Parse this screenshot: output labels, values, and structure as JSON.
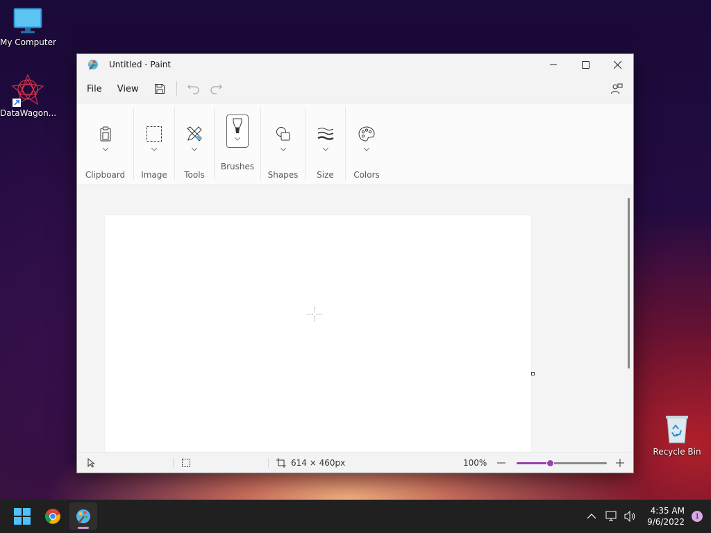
{
  "desktop": {
    "icons": [
      {
        "label": "My Computer"
      },
      {
        "label": "DataWagon..."
      },
      {
        "label": "Recycle Bin"
      }
    ]
  },
  "window": {
    "title": "Untitled - Paint",
    "menu": {
      "file": "File",
      "view": "View"
    },
    "ribbon": {
      "groups": [
        "Clipboard",
        "Image",
        "Tools",
        "Brushes",
        "Shapes",
        "Size",
        "Colors"
      ]
    },
    "status": {
      "canvas_size": "614 × 460px",
      "zoom": "100%",
      "zoom_fraction": 0.38
    }
  },
  "taskbar": {
    "time": "4:35 AM",
    "date": "9/6/2022",
    "notifications": "1"
  },
  "colors": {
    "accent": "#9a3fb0"
  }
}
